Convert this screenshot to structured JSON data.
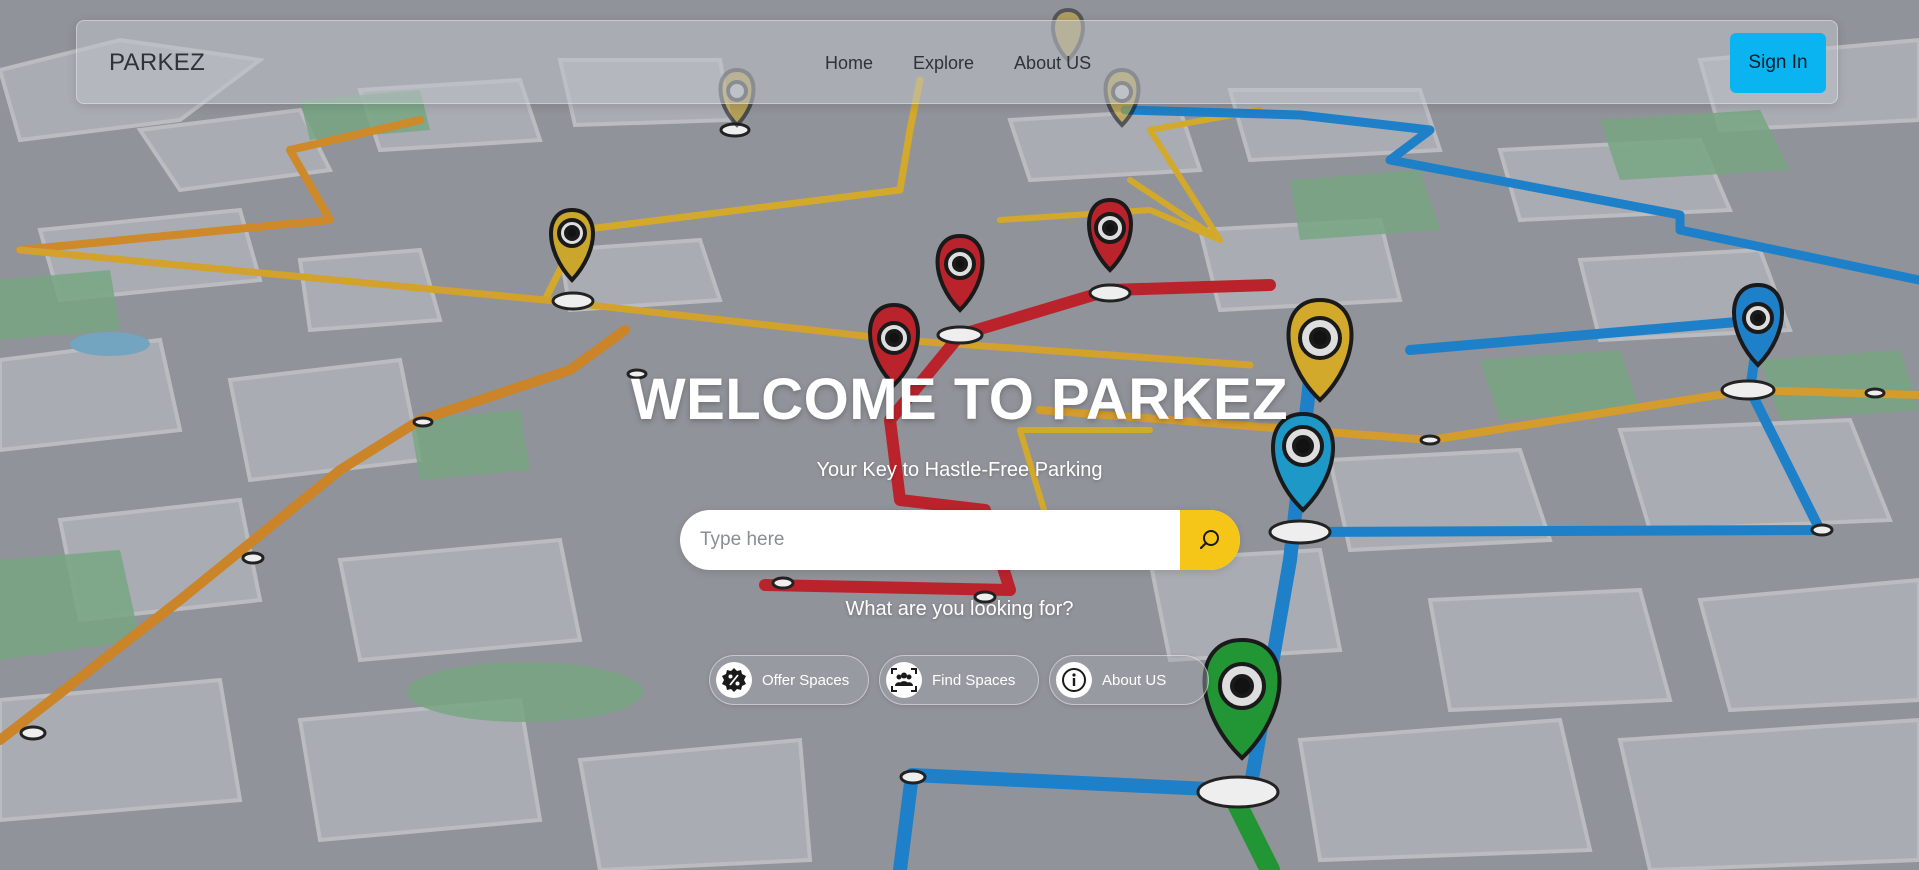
{
  "navbar": {
    "brand": "PARKEZ",
    "links": [
      "Home",
      "Explore",
      "About US"
    ],
    "signin_label": "Sign In"
  },
  "hero": {
    "title": "WELCOME TO PARKEZ",
    "subtitle": "Your Key to Hastle-Free Parking",
    "search_placeholder": "Type here",
    "search_icon": "search-icon",
    "prompt": "What are you looking for?",
    "options": [
      {
        "label": "Offer Spaces",
        "icon": "discount-badge-icon"
      },
      {
        "label": "Find Spaces",
        "icon": "people-scan-icon"
      },
      {
        "label": "About US",
        "icon": "info-icon"
      }
    ]
  },
  "background": {
    "description_colors": {
      "route_orange": "#e0962a",
      "route_yellow": "#e2b52c",
      "route_red": "#c8232c",
      "route_blue": "#1e88d6",
      "route_green": "#22a035",
      "park_green": "#6fae7c",
      "accent_yellow": "#f5c518",
      "accent_cyan": "#0ab4f0"
    }
  }
}
